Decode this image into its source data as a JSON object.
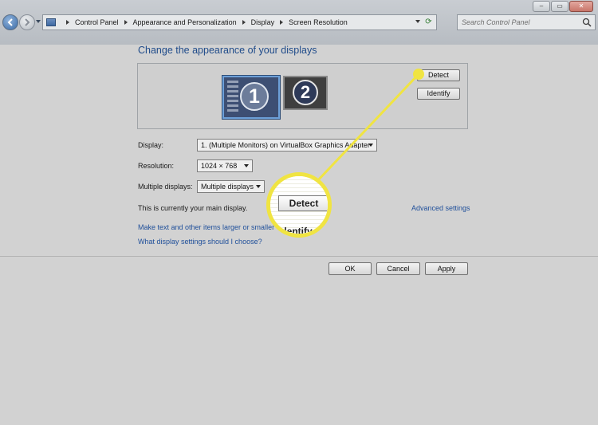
{
  "window": {
    "minimize": "‒",
    "maximize": "▭",
    "close": "✕"
  },
  "address_bar": {
    "crumbs": [
      "Control Panel",
      "Appearance and Personalization",
      "Display",
      "Screen Resolution"
    ]
  },
  "search": {
    "placeholder": "Search Control Panel"
  },
  "main": {
    "heading": "Change the appearance of your displays",
    "monitors": [
      "1",
      "2"
    ],
    "detect_label": "Detect",
    "identify_label": "Identify",
    "display_label": "Display:",
    "display_value": "1. (Multiple Monitors) on VirtualBox Graphics Adapter",
    "resolution_label": "Resolution:",
    "resolution_value": "1024 × 768",
    "multiple_label": "Multiple displays:",
    "multiple_value": "Multiple displays",
    "main_display_text": "This is currently your main display.",
    "advanced_link": "Advanced settings",
    "link_larger": "Make text and other items larger or smaller",
    "link_which": "What display settings should I choose?"
  },
  "footer": {
    "ok": "OK",
    "cancel": "Cancel",
    "apply": "Apply"
  },
  "callout": {
    "zoom_detect": "Detect",
    "zoom_identify": "Identify",
    "color": "#f0e442"
  }
}
